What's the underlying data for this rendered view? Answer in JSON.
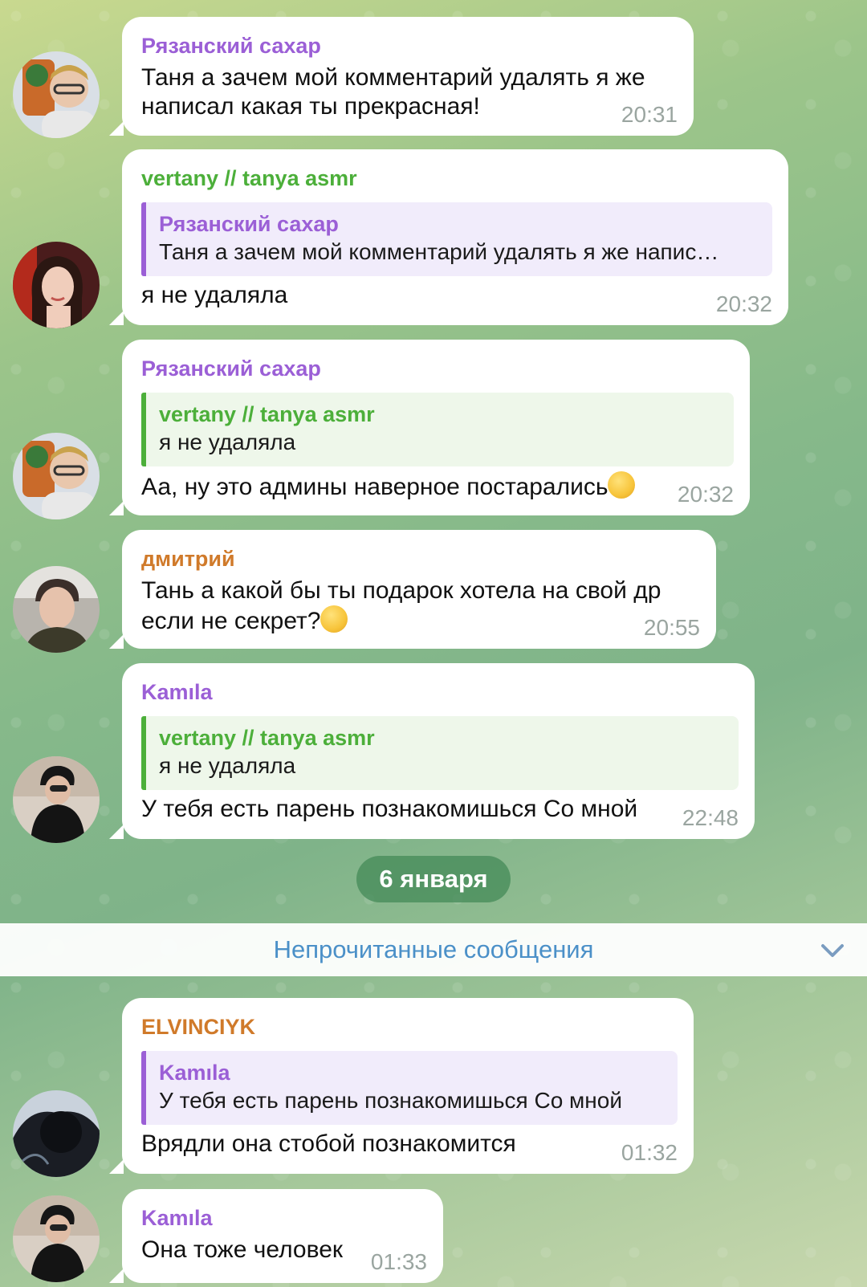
{
  "messages": [
    {
      "sender": "Рязанский сахар",
      "sender_color": "#9b5fd6",
      "text_lines": [
        "Таня а зачем мой комментарий удалять я же",
        "написал какая ты прекрасная!"
      ],
      "time": "20:31"
    },
    {
      "sender": "vertany // tanya asmr",
      "sender_color": "#4caf3a",
      "reply": {
        "name": "Рязанский сахар",
        "text": "Таня а зачем мой комментарий удалять я же напис…"
      },
      "text": "я не удаляла",
      "time": "20:32"
    },
    {
      "sender": "Рязанский сахар",
      "sender_color": "#9b5fd6",
      "reply": {
        "name": "vertany // tanya asmr",
        "text": "я не удаляла"
      },
      "text": "Аа, ну это админы наверное постарались",
      "emoji": "grinning-sweat-emoji",
      "time": "20:32"
    },
    {
      "sender": "дмитрий",
      "sender_color": "#d07a2a",
      "text_lines": [
        "Тань а какой бы ты подарок хотела на свой др",
        "если не секрет?"
      ],
      "emoji": "thinking-face-emoji",
      "time": "20:55"
    },
    {
      "sender": "Kamıla",
      "sender_color": "#9b5fd6",
      "reply": {
        "name": "vertany // tanya asmr",
        "text": "я не удаляла"
      },
      "text": "У тебя есть парень познакомишься Со мной",
      "time": "22:48"
    },
    {
      "sender": "ELVINCIYK",
      "sender_color": "#d07a2a",
      "reply": {
        "name": "Kamıla",
        "text": "У тебя есть парень познакомишься Со мной"
      },
      "text": "Врядли она стобой познакомится",
      "time": "01:32"
    },
    {
      "sender": "Kamıla",
      "sender_color": "#9b5fd6",
      "text": "Она тоже человек",
      "time": "01:33"
    }
  ],
  "date_separator": "6 января",
  "unread_banner": {
    "label": "Непрочитанные сообщения",
    "icon": "chevron-down-icon"
  },
  "colors": {
    "purple": "#9b5fd6",
    "green": "#4caf3a",
    "orange": "#d07a2a",
    "link_blue": "#4b90c8",
    "time_gray": "#9aa5a0"
  }
}
